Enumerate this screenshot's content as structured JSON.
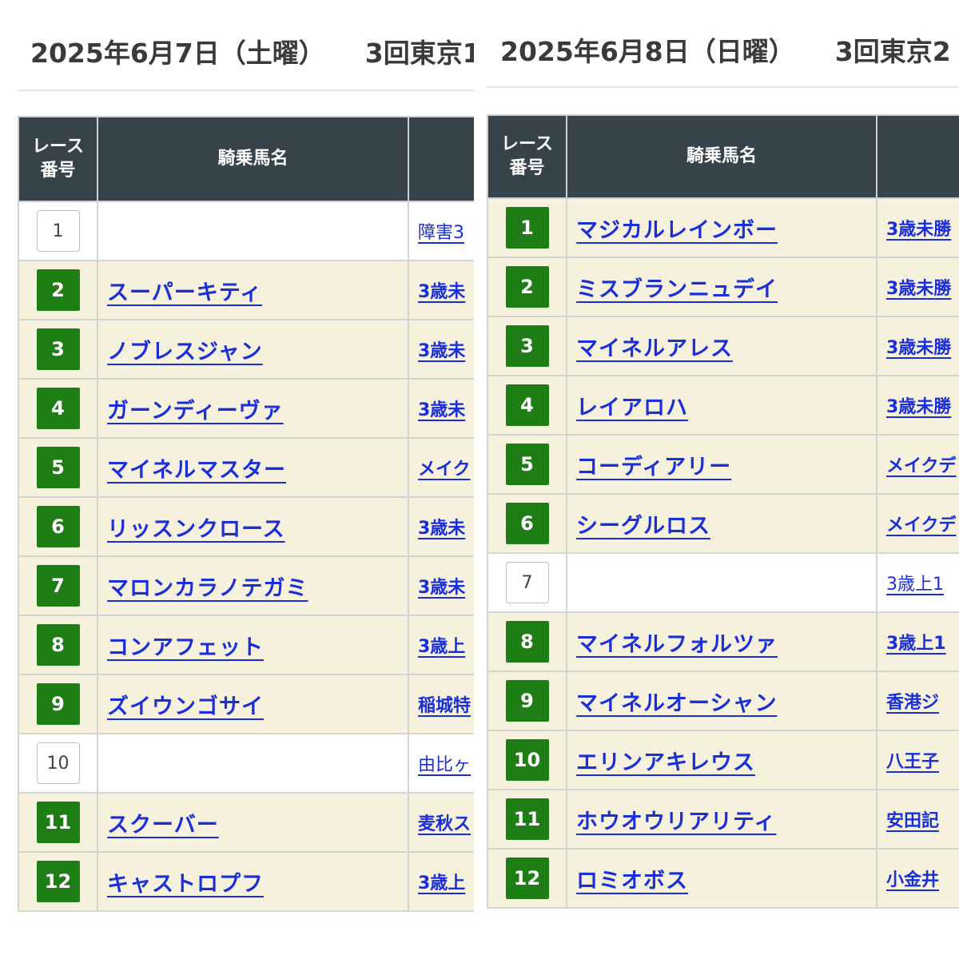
{
  "table_headers": {
    "race_no_line1": "レース",
    "race_no_line2": "番号",
    "horse": "騎乗馬名"
  },
  "left": {
    "date": "2025年6月7日（土曜）",
    "meeting": "3回東京1",
    "rows": [
      {
        "no": "1",
        "horse": "",
        "race": "障害3",
        "highlight": false
      },
      {
        "no": "2",
        "horse": "スーパーキティ",
        "race": "3歳未",
        "highlight": true
      },
      {
        "no": "3",
        "horse": "ノブレスジャン",
        "race": "3歳未",
        "highlight": true
      },
      {
        "no": "4",
        "horse": "ガーンディーヴァ",
        "race": "3歳未",
        "highlight": true
      },
      {
        "no": "5",
        "horse": "マイネルマスター",
        "race": "メイク",
        "highlight": true
      },
      {
        "no": "6",
        "horse": "リッスンクロース",
        "race": "3歳未",
        "highlight": true
      },
      {
        "no": "7",
        "horse": "マロンカラノテガミ",
        "race": "3歳未",
        "highlight": true
      },
      {
        "no": "8",
        "horse": "コンアフェット",
        "race": "3歳上",
        "highlight": true
      },
      {
        "no": "9",
        "horse": "ズイウンゴサイ",
        "race": "稲城特",
        "highlight": true
      },
      {
        "no": "10",
        "horse": "",
        "race": "由比ヶ",
        "highlight": false
      },
      {
        "no": "11",
        "horse": "スクーバー",
        "race": "麦秋ス",
        "highlight": true
      },
      {
        "no": "12",
        "horse": "キャストロプフ",
        "race": "3歳上",
        "highlight": true
      }
    ]
  },
  "right": {
    "date": "2025年6月8日（日曜）",
    "meeting": "3回東京2",
    "rows": [
      {
        "no": "1",
        "horse": "マジカルレインボー",
        "race": "3歳未勝",
        "highlight": true
      },
      {
        "no": "2",
        "horse": "ミスブランニュデイ",
        "race": "3歳未勝",
        "highlight": true
      },
      {
        "no": "3",
        "horse": "マイネルアレス",
        "race": "3歳未勝",
        "highlight": true
      },
      {
        "no": "4",
        "horse": "レイアロハ",
        "race": "3歳未勝",
        "highlight": true
      },
      {
        "no": "5",
        "horse": "コーディアリー",
        "race": "メイクデ",
        "highlight": true
      },
      {
        "no": "6",
        "horse": "シーグルロス",
        "race": "メイクデ",
        "highlight": true
      },
      {
        "no": "7",
        "horse": "",
        "race": "3歳上1",
        "highlight": false
      },
      {
        "no": "8",
        "horse": "マイネルフォルツァ",
        "race": "3歳上1",
        "highlight": true
      },
      {
        "no": "9",
        "horse": "マイネルオーシャン",
        "race": "香港ジ",
        "highlight": true
      },
      {
        "no": "10",
        "horse": "エリンアキレウス",
        "race": "八王子",
        "highlight": true
      },
      {
        "no": "11",
        "horse": "ホウオウリアリティ",
        "race": "安田記",
        "highlight": true
      },
      {
        "no": "12",
        "horse": "ロミオボス",
        "race": "小金井",
        "highlight": true
      }
    ]
  }
}
